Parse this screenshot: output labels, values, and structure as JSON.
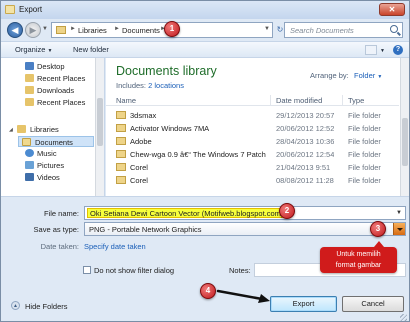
{
  "window": {
    "title": "Export",
    "close_symbol": "✕"
  },
  "address": {
    "crumbs": [
      "Libraries",
      "Documents"
    ],
    "search_placeholder": "Search Documents"
  },
  "toolbar": {
    "organize_label": "Organize",
    "new_folder_label": "New folder"
  },
  "nav": {
    "items": [
      {
        "label": "Desktop",
        "color": "#4a7fc4"
      },
      {
        "label": "Recent Places",
        "color": "#c9a94e"
      },
      {
        "label": "Downloads",
        "color": "#c9a94e"
      },
      {
        "label": "Recent Places",
        "color": "#c9a94e"
      },
      {
        "label": "Libraries",
        "color": "#c9a94e"
      },
      {
        "label": "Documents",
        "color": "#d7b75a"
      },
      {
        "label": "Music",
        "color": "#4c8bd1"
      },
      {
        "label": "Pictures",
        "color": "#4c8bd1"
      },
      {
        "label": "Videos",
        "color": "#4c8bd1"
      }
    ]
  },
  "library": {
    "title": "Documents library",
    "includes_label": "Includes:",
    "includes_link": "2 locations",
    "arrange_label": "Arrange by:",
    "arrange_value": "Folder"
  },
  "table": {
    "columns": [
      "Name",
      "Date modified",
      "Type"
    ],
    "rows": [
      {
        "name": "3dsmax",
        "date": "29/12/2013 20:57",
        "type": "File folder"
      },
      {
        "name": "Activator Windows 7MA",
        "date": "20/06/2012 12:52",
        "type": "File folder"
      },
      {
        "name": "Adobe",
        "date": "28/04/2013 10:36",
        "type": "File folder"
      },
      {
        "name": "Chew-wga 0.9 â€“ The Windows 7 Patch",
        "date": "20/06/2012 12:54",
        "type": "File folder"
      },
      {
        "name": "Corel",
        "date": "21/04/2013 9:51",
        "type": "File folder"
      },
      {
        "name": "Corel",
        "date": "08/08/2012 11:28",
        "type": "File folder"
      }
    ]
  },
  "form": {
    "filename_label": "File name:",
    "filename_value": "Oki Setiana Dewi Cartoon Vector (Motifweb.blogspot.com)",
    "savetype_label": "Save as type:",
    "savetype_value": "PNG - Portable Network Graphics",
    "date_taken_label": "Date taken:",
    "date_taken_link": "Specify date taken",
    "filter_label": "Do not show filter dialog",
    "notes_label": "Notes:",
    "hide_folders_label": "Hide Folders",
    "export_label": "Export",
    "cancel_label": "Cancel"
  },
  "annotations": {
    "badges": [
      "1",
      "2",
      "3",
      "4"
    ],
    "callout_line1": "Untuk memilih",
    "callout_line2": "format gambar",
    "badge_color": "#c0171a",
    "highlight_color": "#f6ff3c"
  }
}
